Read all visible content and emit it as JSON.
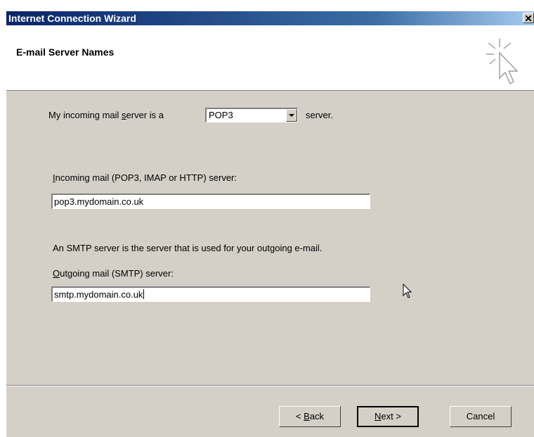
{
  "window": {
    "title": "Internet Connection Wizard",
    "close_icon": "close-icon"
  },
  "header": {
    "title": "E-mail Server Names",
    "icon": "wizard-cursor-icon"
  },
  "incoming_type": {
    "prefix": "My incoming mail ",
    "underlined": "s",
    "middle": "erver is a",
    "selected": "POP3",
    "suffix": "server."
  },
  "incoming_server": {
    "label_underlined": "I",
    "label_rest": "ncoming mail (POP3, IMAP or HTTP) server:",
    "value": "pop3.mydomain.co.uk"
  },
  "smtp_info": "An SMTP server is the server that is used for your outgoing e-mail.",
  "outgoing_server": {
    "label_underlined": "O",
    "label_rest": "utgoing mail (SMTP) server:",
    "value": "smtp.mydomain.co.uk"
  },
  "buttons": {
    "back_prefix": "< ",
    "back_underlined": "B",
    "back_rest": "ack",
    "next_underlined": "N",
    "next_rest": "ext >",
    "cancel": "Cancel"
  }
}
